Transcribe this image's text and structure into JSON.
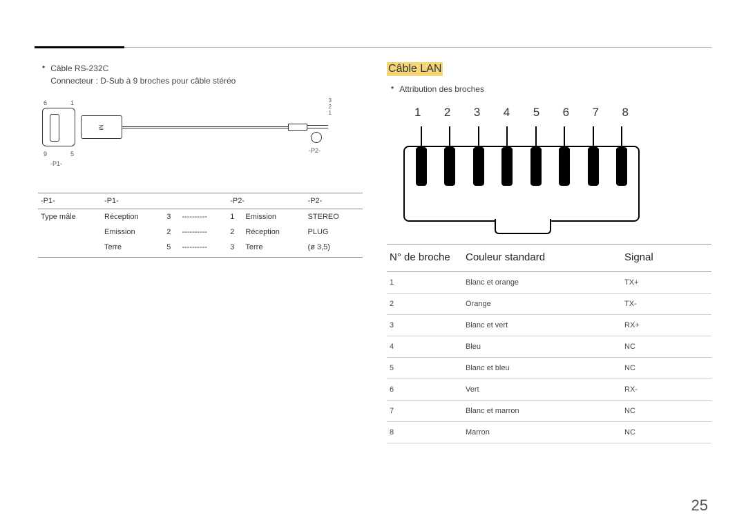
{
  "left": {
    "bullet_cable": "Câble RS-232C",
    "connector_text": "Connecteur : D-Sub à 9 broches pour câble stéréo",
    "dsub_labels": {
      "tl": "6",
      "tr": "1",
      "bl": "9",
      "br": "5",
      "p1": "-P1-"
    },
    "jack_labels": {
      "l3": "3",
      "l2": "2",
      "l1": "1",
      "p2": "-P2-"
    },
    "plug_in": "IN",
    "table": {
      "headers": [
        "-P1-",
        "-P1-",
        "",
        "-P2-",
        "",
        "-P2-"
      ],
      "rows": [
        [
          "Type mâle",
          "Réception",
          "3",
          "----------",
          "1",
          "Emission",
          "STEREO"
        ],
        [
          "",
          "Emission",
          "2",
          "----------",
          "2",
          "Réception",
          "PLUG"
        ],
        [
          "",
          "Terre",
          "5",
          "----------",
          "3",
          "Terre",
          "(ø 3,5)"
        ]
      ]
    }
  },
  "right": {
    "title": "Câble LAN",
    "bullet_pins": "Attribution des broches",
    "pin_numbers": [
      "1",
      "2",
      "3",
      "4",
      "5",
      "6",
      "7",
      "8"
    ],
    "table": {
      "headers": {
        "pin": "N° de broche",
        "color": "Couleur standard",
        "signal": "Signal"
      },
      "rows": [
        {
          "pin": "1",
          "color": "Blanc et orange",
          "signal": "TX+"
        },
        {
          "pin": "2",
          "color": "Orange",
          "signal": "TX-"
        },
        {
          "pin": "3",
          "color": "Blanc et vert",
          "signal": "RX+"
        },
        {
          "pin": "4",
          "color": "Bleu",
          "signal": "NC"
        },
        {
          "pin": "5",
          "color": "Blanc et bleu",
          "signal": "NC"
        },
        {
          "pin": "6",
          "color": "Vert",
          "signal": "RX-"
        },
        {
          "pin": "7",
          "color": "Blanc et marron",
          "signal": "NC"
        },
        {
          "pin": "8",
          "color": "Marron",
          "signal": "NC"
        }
      ]
    }
  },
  "page_number": "25"
}
